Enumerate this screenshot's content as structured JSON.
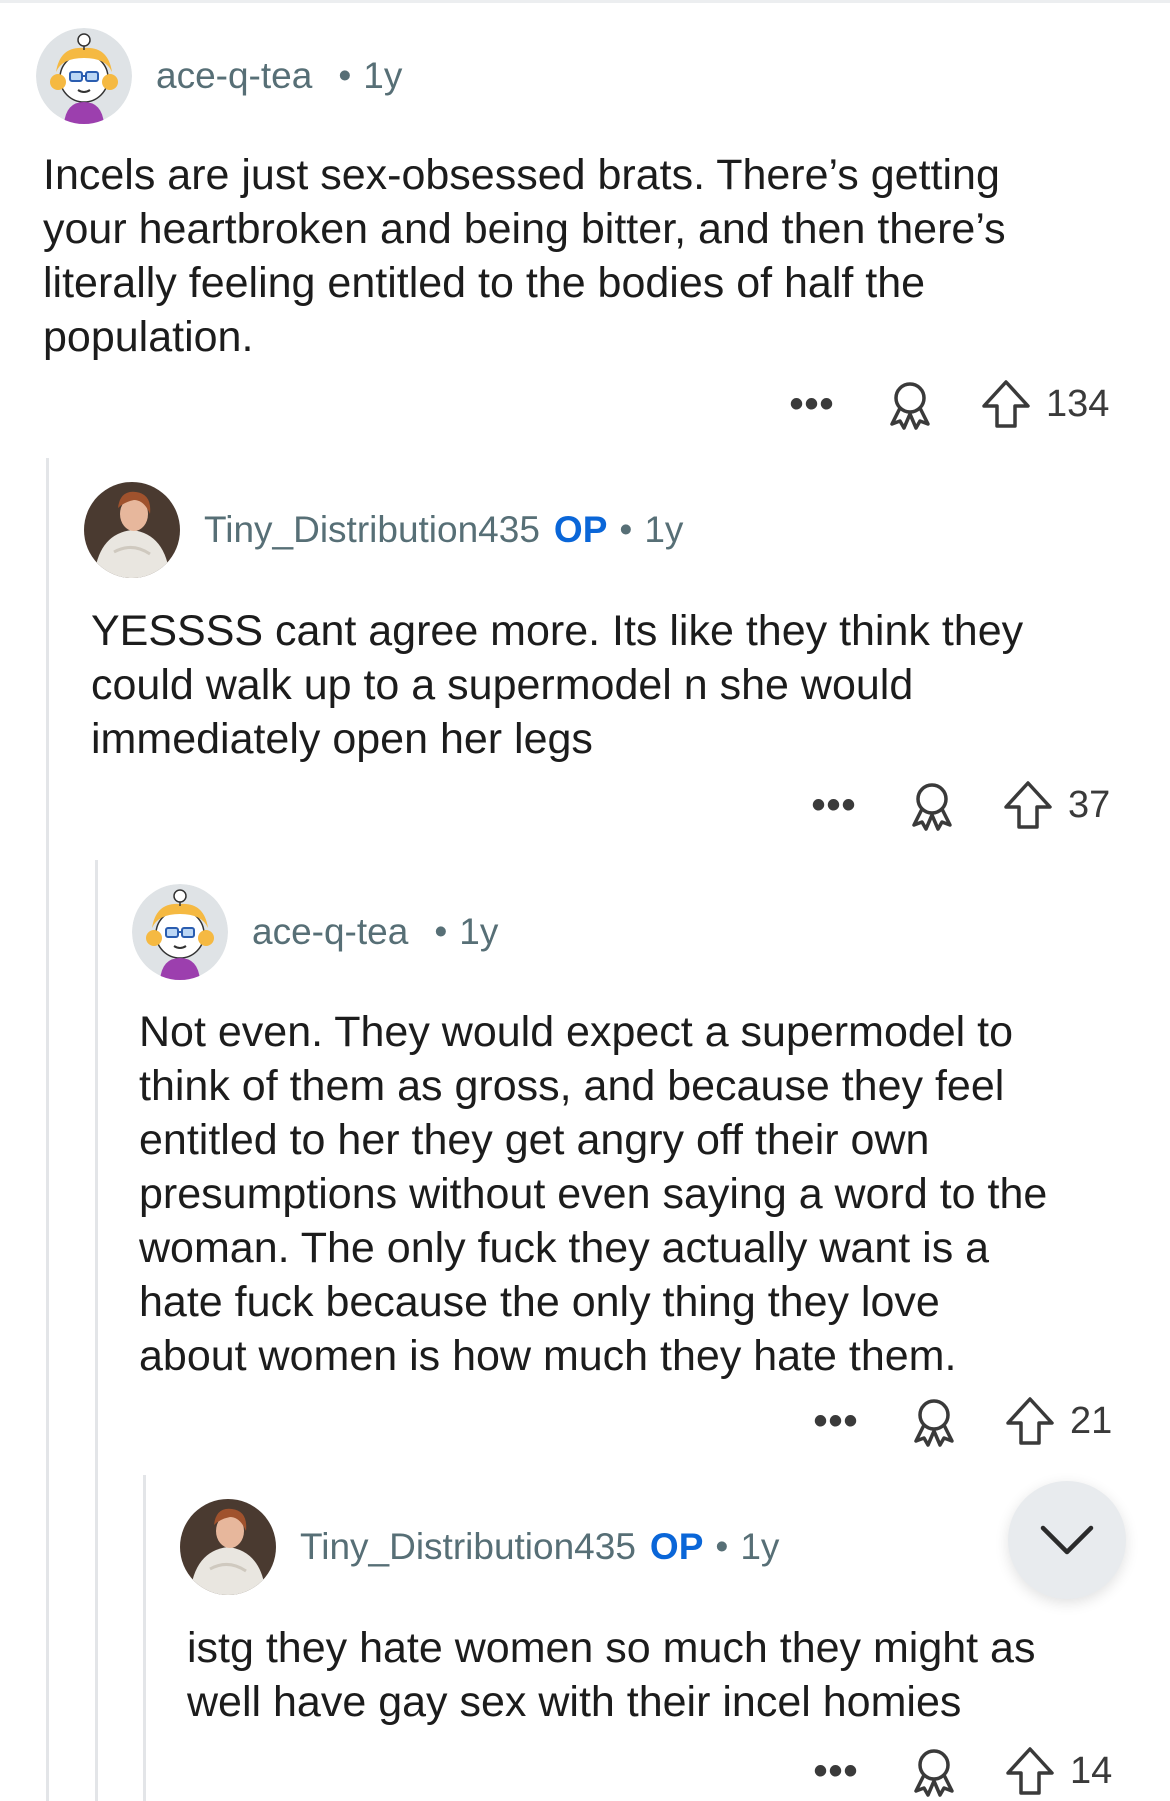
{
  "comments": [
    {
      "author": "ace-q-tea",
      "op": "",
      "age": "1y",
      "text": "Incels are just sex-obsessed brats. There’s getting\nyour heartbroken and being bitter, and then there’s\nliterally feeling entitled to the bodies of half the\npopulation.",
      "score": "134",
      "avatar_icon": "snoo-avatar-icon"
    },
    {
      "author": "Tiny_Distribution435",
      "op": "OP",
      "age": "1y",
      "text": "YESSSS cant agree more. Its like they think they\ncould walk up to a supermodel n she would\nimmediately open her legs",
      "score": "37",
      "avatar_icon": "profile-photo-avatar-icon"
    },
    {
      "author": "ace-q-tea",
      "op": "",
      "age": "1y",
      "text": "Not even. They would expect a supermodel to\nthink of them as gross, and because they feel\nentitled to her they get angry off their own\npresumptions without even saying a word to the\nwoman. The only fuck they actually want is a\nhate fuck because the only thing they love\nabout women is how much they hate them.",
      "score": "21",
      "avatar_icon": "snoo-avatar-icon"
    },
    {
      "author": "Tiny_Distribution435",
      "op": "OP",
      "age": "1y",
      "text": "istg they hate women so much they might as\nwell have gay sex with their incel homies",
      "score": "14",
      "avatar_icon": "profile-photo-avatar-icon"
    }
  ],
  "separator": "•",
  "more_label": "•••",
  "colors": {
    "op_badge": "#0a66d8",
    "meta_text": "#576f76",
    "body_text": "#1c1c1c",
    "thread_line": "#e3e5e8"
  }
}
